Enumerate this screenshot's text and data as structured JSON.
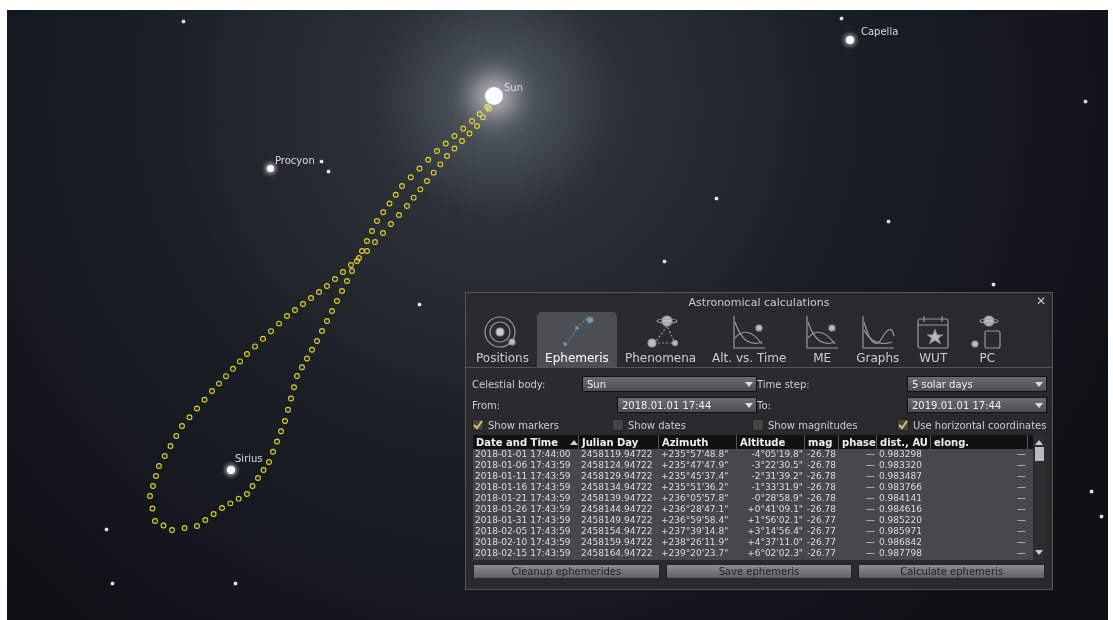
{
  "sky": {
    "labels": [
      {
        "kind": "star",
        "text": "Capella"
      },
      {
        "kind": "sun",
        "text": "Sun"
      },
      {
        "kind": "star",
        "text": "Procyon"
      },
      {
        "kind": "star",
        "text": "Sirius"
      }
    ]
  },
  "dialog": {
    "title": "Astronomical calculations",
    "close": "✕",
    "tabs": [
      {
        "kind": "positions",
        "label": "Positions",
        "selected": false
      },
      {
        "kind": "ephemeris",
        "label": "Ephemeris",
        "selected": true
      },
      {
        "kind": "phenomena",
        "label": "Phenomena",
        "selected": false
      },
      {
        "kind": "graph",
        "label": "Alt. vs. Time",
        "selected": false
      },
      {
        "kind": "graph",
        "label": "ME",
        "selected": false
      },
      {
        "kind": "graph2",
        "label": "Graphs",
        "selected": false
      },
      {
        "kind": "calendar",
        "label": "WUT",
        "selected": false
      },
      {
        "kind": "pc",
        "label": "PC",
        "selected": false
      }
    ],
    "fields": [
      {
        "label": "Celestial body:",
        "value": "Sun"
      },
      {
        "label": "Time step:",
        "value": "5 solar days"
      },
      {
        "label": "From:",
        "value": "2018.01.01 17:44"
      },
      {
        "label": "To:",
        "value": "2019.01.01 17:44"
      }
    ],
    "options": [
      {
        "label": "Show markers",
        "checked": true
      },
      {
        "label": "Show dates",
        "checked": false
      },
      {
        "label": "Show magnitudes",
        "checked": false
      },
      {
        "label": "Use horizontal coordinates",
        "checked": true
      }
    ],
    "table": {
      "columns": [
        "Date and Time",
        "Julian Day",
        "Azimuth",
        "Altitude",
        "mag",
        "phase",
        "dist., AU",
        "elong."
      ],
      "rows": [
        [
          "2018-01-01 17:44:00",
          "2458119.94722",
          "+235°57'48.8\"",
          "-4°05'19.8\"",
          "-26.78",
          "—",
          "0.983298",
          "—"
        ],
        [
          "2018-01-06 17:43:59",
          "2458124.94722",
          "+235°47'47.9\"",
          "-3°22'30.5\"",
          "-26.78",
          "—",
          "0.983320",
          "—"
        ],
        [
          "2018-01-11 17:43:59",
          "2458129.94722",
          "+235°45'37.4\"",
          "-2°31'39.2\"",
          "-26.78",
          "—",
          "0.983487",
          "—"
        ],
        [
          "2018-01-16 17:43:59",
          "2458134.94722",
          "+235°51'36.2\"",
          "-1°33'31.9\"",
          "-26.78",
          "—",
          "0.983766",
          "—"
        ],
        [
          "2018-01-21 17:43:59",
          "2458139.94722",
          "+236°05'57.8\"",
          "-0°28'58.9\"",
          "-26.78",
          "—",
          "0.984141",
          "—"
        ],
        [
          "2018-01-26 17:43:59",
          "2458144.94722",
          "+236°28'47.1\"",
          "+0°41'09.1\"",
          "-26.78",
          "—",
          "0.984616",
          "—"
        ],
        [
          "2018-01-31 17:43:59",
          "2458149.94722",
          "+236°59'58.4\"",
          "+1°56'02.1\"",
          "-26.77",
          "—",
          "0.985220",
          "—"
        ],
        [
          "2018-02-05 17:43:59",
          "2458154.94722",
          "+237°39'14.8\"",
          "+3°14'56.4\"",
          "-26.77",
          "—",
          "0.985971",
          "—"
        ],
        [
          "2018-02-10 17:43:59",
          "2458159.94722",
          "+238°26'11.9\"",
          "+4°37'11.0\"",
          "-26.77",
          "—",
          "0.986842",
          "—"
        ],
        [
          "2018-02-15 17:43:59",
          "2458164.94722",
          "+239°20'23.7\"",
          "+6°02'02.3\"",
          "-26.77",
          "—",
          "0.987798",
          "—"
        ]
      ]
    },
    "buttons": [
      "Cleanup ephemerides",
      "Save ephemeris",
      "Calculate ephemeris"
    ]
  }
}
